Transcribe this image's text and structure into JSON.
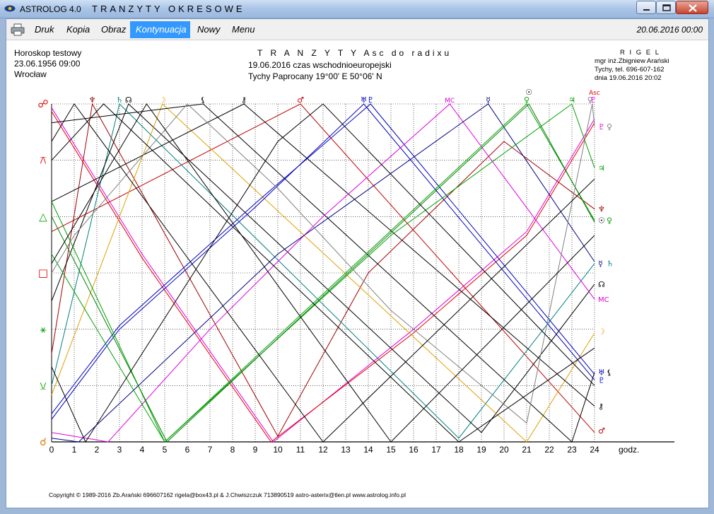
{
  "window": {
    "app_name": "ASTROLOG 4.0",
    "document_title": "TRANZYTY OKRESOWE"
  },
  "menu": {
    "items": [
      "Druk",
      "Kopia",
      "Obraz",
      "Kontynuacja",
      "Nowy",
      "Menu"
    ],
    "active_index": 3,
    "datetime": "20.06.2016  00:00"
  },
  "header": {
    "left": [
      "Horoskop testowy",
      "23.06.1956  09:00",
      "Wrocław"
    ],
    "center": [
      "T R A N Z Y T Y   Asc do radixu",
      "19.06.2016  czas wschodnioeuropejski",
      "Tychy Paprocany  19°00' E  50°06' N"
    ],
    "right": [
      "R I G E L",
      "mgr inż.Zbigniew Arański",
      "Tychy, tel. 696-607-162",
      "dnia 19.06.2016  20:02"
    ]
  },
  "chart_data": {
    "type": "line",
    "xlabel": "godz.",
    "x_ticks": [
      "0",
      "1",
      "2",
      "3",
      "4",
      "5",
      "6",
      "7",
      "8",
      "9",
      "10",
      "11",
      "12",
      "13",
      "14",
      "15",
      "16",
      "17",
      "18",
      "19",
      "20",
      "21",
      "22",
      "23",
      "24"
    ],
    "xlim": [
      0,
      24
    ],
    "ylim": [
      0,
      180
    ],
    "aspect_labels": [
      {
        "symbol": "☍",
        "degrees": 180,
        "color": "#e00000"
      },
      {
        "symbol": "⚻",
        "degrees": 150,
        "color": "#e00000"
      },
      {
        "symbol": "△",
        "degrees": 120,
        "color": "#00a000"
      },
      {
        "symbol": "□",
        "degrees": 90,
        "color": "#e00000"
      },
      {
        "symbol": "⚹",
        "degrees": 60,
        "color": "#00a000"
      },
      {
        "symbol": "⚺",
        "degrees": 30,
        "color": "#00a000"
      },
      {
        "symbol": "☌",
        "degrees": 0,
        "color": "#e08000"
      }
    ],
    "top_labels": [
      {
        "symbol": "♆",
        "x": 1.8,
        "color": "#a00000"
      },
      {
        "symbol": "♄",
        "x": 3.0,
        "color": "#008080"
      },
      {
        "symbol": "☊",
        "x": 3.4,
        "color": "#000000"
      },
      {
        "symbol": "☽",
        "x": 4.9,
        "color": "#e0a000"
      },
      {
        "symbol": "⚸",
        "x": 6.7,
        "color": "#000000"
      },
      {
        "symbol": "⚷",
        "x": 8.5,
        "color": "#000000"
      },
      {
        "symbol": "♂",
        "x": 11.0,
        "color": "#c00000"
      },
      {
        "symbol": "♅",
        "x": 13.8,
        "color": "#0000c0"
      },
      {
        "symbol": "♇",
        "x": 14.1,
        "color": "#0000c0"
      },
      {
        "symbol": "MC",
        "x": 17.6,
        "color": "#e000e0"
      },
      {
        "symbol": "☿",
        "x": 19.3,
        "color": "#000080"
      },
      {
        "symbol": "♀",
        "x": 21.0,
        "color": "#00a000"
      },
      {
        "symbol": "☉",
        "x": 21.1,
        "color": "#000000"
      },
      {
        "symbol": "♃",
        "x": 23.0,
        "color": "#00a000"
      },
      {
        "symbol": "♀",
        "x": 23.8,
        "color": "#808080"
      },
      {
        "symbol": "Asc",
        "x": 24.0,
        "color": "#e00000"
      },
      {
        "symbol": "♇",
        "x": 23.95,
        "color": "#e000e0"
      }
    ],
    "right_labels": [
      {
        "symbols": [
          {
            "s": "♇",
            "c": "#e000e0"
          },
          {
            "s": "♀",
            "c": "#808080"
          }
        ],
        "degrees": 168
      },
      {
        "symbols": [
          {
            "s": "♃",
            "c": "#00a000"
          }
        ],
        "degrees": 146
      },
      {
        "symbols": [
          {
            "s": "♆",
            "c": "#a00000"
          }
        ],
        "degrees": 124
      },
      {
        "symbols": [
          {
            "s": "☉",
            "c": "#000000"
          },
          {
            "s": "♀",
            "c": "#00a000"
          }
        ],
        "degrees": 118
      },
      {
        "symbols": [
          {
            "s": "☿",
            "c": "#000080"
          },
          {
            "s": "♄",
            "c": "#008080"
          }
        ],
        "degrees": 95
      },
      {
        "symbols": [
          {
            "s": "☊",
            "c": "#000000"
          }
        ],
        "degrees": 84
      },
      {
        "symbols": [
          {
            "s": "MC",
            "c": "#e000e0"
          }
        ],
        "degrees": 76
      },
      {
        "symbols": [
          {
            "s": "☽",
            "c": "#e0a000"
          }
        ],
        "degrees": 59
      },
      {
        "symbols": [
          {
            "s": "♅",
            "c": "#0000c0"
          },
          {
            "s": "⚸",
            "c": "#000000"
          }
        ],
        "degrees": 37
      },
      {
        "symbols": [
          {
            "s": "♇",
            "c": "#0000c0"
          }
        ],
        "degrees": 33
      },
      {
        "symbols": [
          {
            "s": "⚷",
            "c": "#000000"
          }
        ],
        "degrees": 19
      },
      {
        "symbols": [
          {
            "s": "♂",
            "c": "#c00000"
          }
        ],
        "degrees": 6
      }
    ],
    "series": [
      {
        "color": "#e000e0",
        "points": [
          [
            0,
            178
          ],
          [
            4,
            100
          ],
          [
            9.8,
            0
          ],
          [
            16,
            60
          ],
          [
            21,
            112
          ],
          [
            24,
            172
          ]
        ]
      },
      {
        "color": "#e00000",
        "points": [
          [
            0,
            176
          ],
          [
            4,
            98
          ],
          [
            9.7,
            0
          ],
          [
            16,
            58
          ],
          [
            21,
            110
          ],
          [
            24,
            170
          ]
        ]
      },
      {
        "color": "#c00000",
        "points": [
          [
            0,
            112
          ],
          [
            11,
            180
          ],
          [
            24,
            5
          ]
        ]
      },
      {
        "color": "#a00000",
        "points": [
          [
            0,
            47
          ],
          [
            1.8,
            180
          ],
          [
            10,
            3
          ],
          [
            14,
            90
          ],
          [
            20,
            160
          ],
          [
            24,
            124
          ]
        ]
      },
      {
        "color": "#008080",
        "points": [
          [
            0,
            30
          ],
          [
            3.0,
            180
          ],
          [
            18,
            2
          ],
          [
            24,
            95
          ]
        ]
      },
      {
        "color": "#000000",
        "points": [
          [
            0,
            75
          ],
          [
            3.4,
            180
          ],
          [
            19,
            5
          ],
          [
            24,
            84
          ]
        ]
      },
      {
        "color": "#e0a000",
        "points": [
          [
            0,
            25
          ],
          [
            4.9,
            180
          ],
          [
            21,
            0
          ],
          [
            24,
            58
          ]
        ]
      },
      {
        "color": "#000000",
        "points": [
          [
            0,
            170
          ],
          [
            6.7,
            180
          ],
          [
            23,
            0
          ],
          [
            24,
            37
          ]
        ]
      },
      {
        "color": "#000000",
        "points": [
          [
            0,
            128
          ],
          [
            8.5,
            180
          ],
          [
            24,
            19
          ]
        ]
      },
      {
        "color": "#0000c0",
        "points": [
          [
            0,
            12
          ],
          [
            3,
            60
          ],
          [
            9,
            125
          ],
          [
            13.8,
            180
          ],
          [
            24,
            33
          ]
        ]
      },
      {
        "color": "#0000c0",
        "points": [
          [
            0,
            15
          ],
          [
            3,
            62
          ],
          [
            9,
            127
          ],
          [
            14.1,
            180
          ],
          [
            24,
            36
          ]
        ]
      },
      {
        "color": "#e000e0",
        "points": [
          [
            0,
            5
          ],
          [
            2.5,
            0
          ],
          [
            7,
            60
          ],
          [
            12,
            120
          ],
          [
            17.6,
            180
          ],
          [
            24,
            76
          ]
        ]
      },
      {
        "color": "#000080",
        "points": [
          [
            0,
            2
          ],
          [
            1.2,
            0
          ],
          [
            10,
            100
          ],
          [
            19.3,
            180
          ],
          [
            24,
            96
          ]
        ]
      },
      {
        "color": "#00a000",
        "points": [
          [
            0,
            128
          ],
          [
            5,
            0
          ],
          [
            13,
            90
          ],
          [
            21,
            180
          ],
          [
            24,
            118
          ]
        ]
      },
      {
        "color": "#00a000",
        "points": [
          [
            0,
            100
          ],
          [
            3,
            40
          ],
          [
            5,
            0
          ],
          [
            15,
            110
          ],
          [
            23,
            180
          ],
          [
            24,
            146
          ]
        ]
      },
      {
        "color": "#008000",
        "points": [
          [
            0,
            120
          ],
          [
            5.1,
            0
          ],
          [
            21.1,
            180
          ],
          [
            24,
            117
          ]
        ]
      },
      {
        "color": "#808080",
        "points": [
          [
            0,
            90
          ],
          [
            1,
            110
          ],
          [
            6,
            180
          ],
          [
            10,
            135
          ],
          [
            15,
            70
          ],
          [
            21,
            10
          ],
          [
            23.9,
            180
          ],
          [
            24,
            168
          ]
        ]
      },
      {
        "color": "#000000",
        "points": [
          [
            0,
            40
          ],
          [
            1.5,
            0
          ],
          [
            10,
            160
          ],
          [
            12,
            180
          ],
          [
            24,
            30
          ]
        ]
      },
      {
        "color": "#000000",
        "points": [
          [
            0,
            150
          ],
          [
            2.3,
            180
          ],
          [
            18,
            0
          ],
          [
            24,
            50
          ]
        ]
      },
      {
        "color": "#000000",
        "points": [
          [
            0,
            95
          ],
          [
            4.2,
            180
          ],
          [
            15,
            0
          ],
          [
            24,
            110
          ]
        ]
      },
      {
        "color": "#000000",
        "points": [
          [
            0,
            160
          ],
          [
            1,
            180
          ],
          [
            12,
            0
          ],
          [
            24,
            140
          ]
        ]
      }
    ]
  },
  "footer": {
    "copyright": "Copyright © 1989-2016 Zb.Arański 696607162 rigela@box43.pl & J.Chwiszczuk 713890519 astro-asterix@tlen.pl www.astrolog.info.pl"
  }
}
